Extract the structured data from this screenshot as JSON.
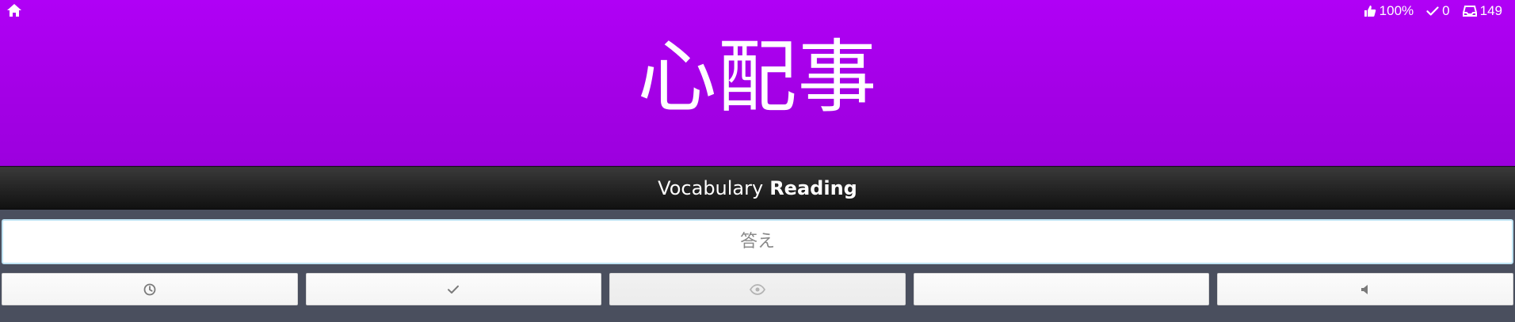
{
  "topbar": {
    "home_icon": "home-icon",
    "stats": [
      {
        "icon": "thumbs-up-icon",
        "value": "100%"
      },
      {
        "icon": "checkmark-icon",
        "value": "0"
      },
      {
        "icon": "inbox-icon",
        "value": "149"
      }
    ]
  },
  "review": {
    "character": "心配事",
    "category": "Vocabulary",
    "type": "Reading"
  },
  "answer": {
    "placeholder": "答え",
    "value": ""
  },
  "actions": [
    {
      "icon": "clock-icon"
    },
    {
      "icon": "checkmark-icon"
    },
    {
      "icon": "eye-icon"
    },
    {
      "icon": "blank"
    },
    {
      "icon": "speaker-icon"
    }
  ],
  "colors": {
    "hero": "#b000f6",
    "bar": "#1f1f1f",
    "input_border": "#bfe3f3"
  }
}
